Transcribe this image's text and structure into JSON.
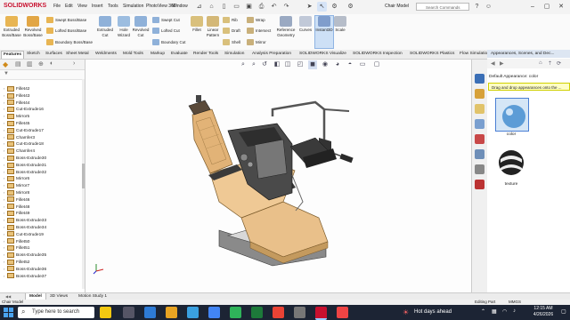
{
  "app": {
    "logo_text": "SOLIDWORKS",
    "doc_title": "Chair Model",
    "search_placeholder": "Search Commands"
  },
  "menu": [
    "File",
    "Edit",
    "View",
    "Insert",
    "Tools",
    "Simulation",
    "PhotoView 360",
    "Window"
  ],
  "ribbon": {
    "extruded_boss": "Extruded Boss/Base",
    "revolved_boss": "Revolved Boss/Base",
    "swept_boss": "Swept Boss/Base",
    "lofted_boss": "Lofted Boss/Base",
    "boundary_boss": "Boundary Boss/Base",
    "extruded_cut": "Extruded Cut",
    "hole_wizard": "Hole Wizard",
    "revolved_cut": "Revolved Cut",
    "swept_cut": "Swept Cut",
    "lofted_cut": "Lofted Cut",
    "boundary_cut": "Boundary Cut",
    "fillet": "Fillet",
    "linear_pattern": "Linear Pattern",
    "rib": "Rib",
    "draft": "Draft",
    "shell": "Shell",
    "wrap": "Wrap",
    "intersect": "Intersect",
    "mirror": "Mirror",
    "reference_geometry": "Reference Geometry",
    "curves": "Curves",
    "instant3d": "Instant3D",
    "scale": "Scale"
  },
  "tabs": [
    "Features",
    "Sketch",
    "Surfaces",
    "Sheet Metal",
    "Weldments",
    "Mold Tools",
    "Markup",
    "Evaluate",
    "Render Tools",
    "Simulation",
    "Analysis Preparation",
    "SOLIDWORKS Visualize",
    "SOLIDWORKS Inspection",
    "SOLIDWORKS Plastics",
    "Flow Simulation"
  ],
  "active_tab": "Features",
  "tree": [
    "Fillet42",
    "Fillet43",
    "Fillet44",
    "Cut-Extrude16",
    "Mirror5",
    "Fillet45",
    "Cut-Extrude17",
    "Chamfer3",
    "Cut-Extrude18",
    "Chamfer4",
    "Boss-Extrude30",
    "Boss-Extrude31",
    "Boss-Extrude32",
    "Mirror6",
    "Mirror7",
    "Mirror8",
    "Fillet46",
    "Fillet48",
    "Fillet49",
    "Boss-Extrude33",
    "Boss-Extrude34",
    "Cut-Extrude19",
    "Fillet50",
    "Fillet51",
    "Boss-Extrude35",
    "Fillet52",
    "Boss-Extrude36",
    "Boss-Extrude37"
  ],
  "taskpane": {
    "header": "Appearances, Scenes, and Dec...",
    "node": "Default Appearance: color",
    "tip": "Drag and drop appearances onto the ...",
    "swatch_color_label": "color",
    "swatch_texture_label": "texture"
  },
  "bottom_tabs": [
    "Model",
    "3D Views",
    "Motion Study 1"
  ],
  "status": {
    "left": "Chair Model",
    "editing": "Editing Part",
    "units": "MMGS"
  },
  "taskbar": {
    "search_placeholder": "Type here to search",
    "weather": "Hot days ahead",
    "time": "12:15 AM",
    "date": "4/26/2026"
  },
  "colors": {
    "accent": "#c8102e",
    "taskbar": "#1c2434",
    "seat": "#e9c08a",
    "frame": "#3a3a3a"
  }
}
